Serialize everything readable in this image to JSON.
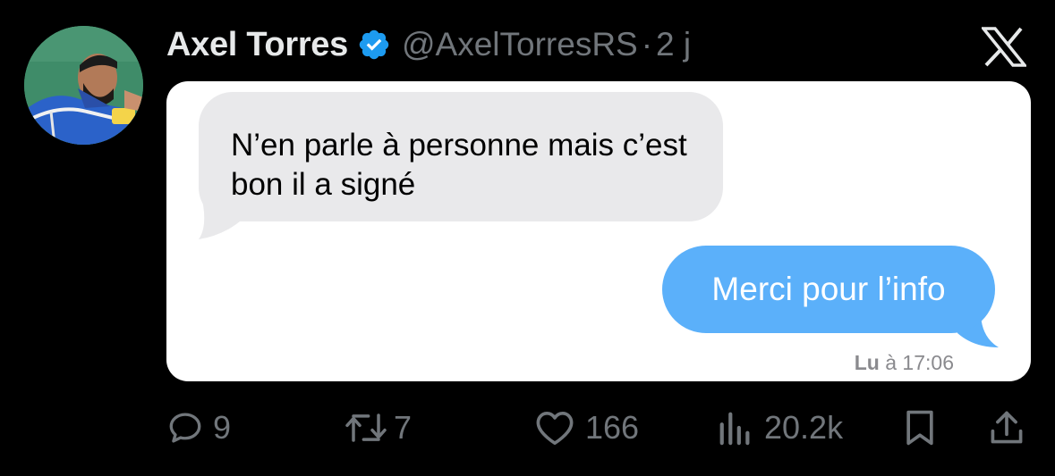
{
  "tweet": {
    "author_name": "Axel Torres",
    "author_handle": "@AxelTorresRS",
    "separator": "·",
    "age": "2 j",
    "verified": true
  },
  "icons": {
    "verified": "verified-badge-icon",
    "brand": "x-logo-icon",
    "reply": "reply-icon",
    "retweet": "retweet-icon",
    "like": "heart-icon",
    "views": "views-chart-icon",
    "bookmark": "bookmark-icon",
    "share": "share-icon"
  },
  "conversation": {
    "incoming_message": "N’en parle à personne mais c’est bon il a signé",
    "outgoing_message": "Merci pour l’info",
    "read_label": "Lu",
    "read_time": "à 17:06"
  },
  "metrics": {
    "replies": "9",
    "retweets": "7",
    "likes": "166",
    "views": "20.2k"
  },
  "colors": {
    "background": "#000000",
    "primary_text": "#e7e9ea",
    "secondary_text": "#71767b",
    "verified_blue": "#1d9bf0",
    "incoming_bubble": "#e9e9eb",
    "outgoing_bubble": "#5bb0fa"
  }
}
